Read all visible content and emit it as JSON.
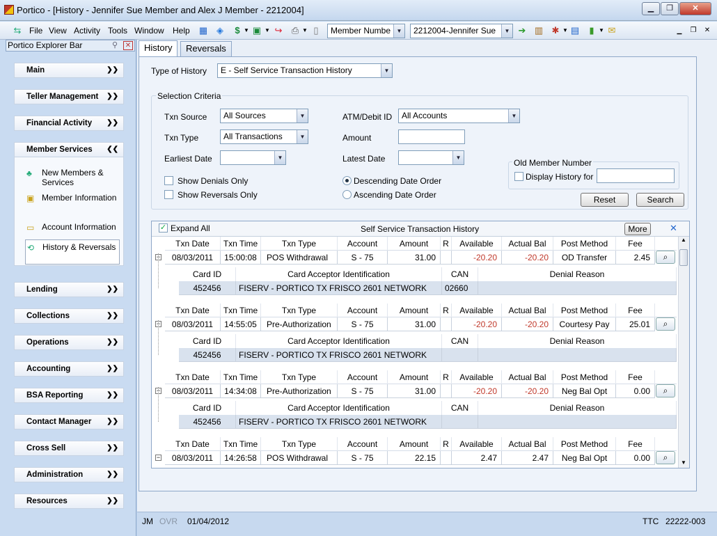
{
  "window": {
    "title": "Portico - [History - Jennifer Sue Member and Alex J Member - 2212004]",
    "min": "▁",
    "restore": "❐",
    "close": "✕"
  },
  "menu": {
    "items": [
      "File",
      "View",
      "Activity",
      "Tools",
      "Window",
      "Help"
    ]
  },
  "toolbar": {
    "search_type": "Member Numbe",
    "member": "2212004-Jennifer Sue"
  },
  "explorer": {
    "title": "Portico Explorer Bar",
    "groups_top": [
      "Main",
      "Teller Management",
      "Financial Activity",
      "Member Services"
    ],
    "member_services_items": [
      {
        "label": "New Members & Services",
        "icon": "people-icon"
      },
      {
        "label": "Member Information",
        "icon": "member-card-icon"
      },
      {
        "label": "Account Information",
        "icon": "folder-icon"
      },
      {
        "label": "History & Reversals",
        "icon": "history-icon"
      }
    ],
    "groups_bottom": [
      "Lending",
      "Collections",
      "Operations",
      "Accounting",
      "BSA Reporting",
      "Contact Manager",
      "Cross Sell",
      "Administration",
      "Resources"
    ]
  },
  "tabs": [
    "History",
    "Reversals"
  ],
  "form": {
    "type_of_history_label": "Type of History",
    "type_of_history_value": "E - Self Service Transaction History",
    "selection_criteria": "Selection Criteria",
    "txn_source_label": "Txn Source",
    "txn_source_value": "All Sources",
    "txn_type_label": "Txn Type",
    "txn_type_value": "All Transactions",
    "earliest_date_label": "Earliest Date",
    "atm_label": "ATM/Debit ID",
    "atm_value": "All Accounts",
    "amount_label": "Amount",
    "latest_date_label": "Latest Date",
    "show_denials": "Show Denials Only",
    "show_reversals": "Show Reversals Only",
    "desc_order": "Descending Date Order",
    "asc_order": "Ascending Date Order",
    "old_member_title": "Old Member Number",
    "display_history_for": "Display History for",
    "reset": "Reset",
    "search": "Search"
  },
  "grid": {
    "expand_all": "Expand All",
    "title": "Self Service Transaction History",
    "more": "More",
    "columns": [
      "Txn Date",
      "Txn Time",
      "Txn Type",
      "Account",
      "Amount",
      "R",
      "Available",
      "Actual Bal",
      "Post Method",
      "Fee"
    ],
    "sub_columns": [
      "Card ID",
      "Card Acceptor Identification",
      "CAN",
      "Denial Reason"
    ],
    "rows": [
      {
        "date": "08/03/2011",
        "time": "15:00:08",
        "type": "POS Withdrawal",
        "account": "S - 75",
        "amount": "31.00",
        "r": "",
        "available": "-20.20",
        "actual": "-20.20",
        "post": "OD Transfer",
        "fee": "2.45",
        "card": "452456",
        "acceptor": "FISERV - PORTICO TX FRISCO 2601 NETWORK",
        "can": "02660",
        "denial": ""
      },
      {
        "date": "08/03/2011",
        "time": "14:55:05",
        "type": "Pre-Authorization",
        "account": "S - 75",
        "amount": "31.00",
        "r": "",
        "available": "-20.20",
        "actual": "-20.20",
        "post": "Courtesy Pay",
        "fee": "25.01",
        "card": "452456",
        "acceptor": "FISERV - PORTICO TX FRISCO 2601 NETWORK",
        "can": "",
        "denial": ""
      },
      {
        "date": "08/03/2011",
        "time": "14:34:08",
        "type": "Pre-Authorization",
        "account": "S - 75",
        "amount": "31.00",
        "r": "",
        "available": "-20.20",
        "actual": "-20.20",
        "post": "Neg Bal Opt",
        "fee": "0.00",
        "card": "452456",
        "acceptor": "FISERV - PORTICO TX FRISCO 2601 NETWORK",
        "can": "",
        "denial": ""
      },
      {
        "date": "08/03/2011",
        "time": "14:26:58",
        "type": "POS Withdrawal",
        "account": "S - 75",
        "amount": "22.15",
        "r": "",
        "available": "2.47",
        "actual": "2.47",
        "post": "Neg Bal Opt",
        "fee": "0.00"
      }
    ]
  },
  "status": {
    "user": "JM",
    "ovr": "OVR",
    "date": "01/04/2012",
    "ttc": "TTC",
    "terminal": "22222-003"
  }
}
